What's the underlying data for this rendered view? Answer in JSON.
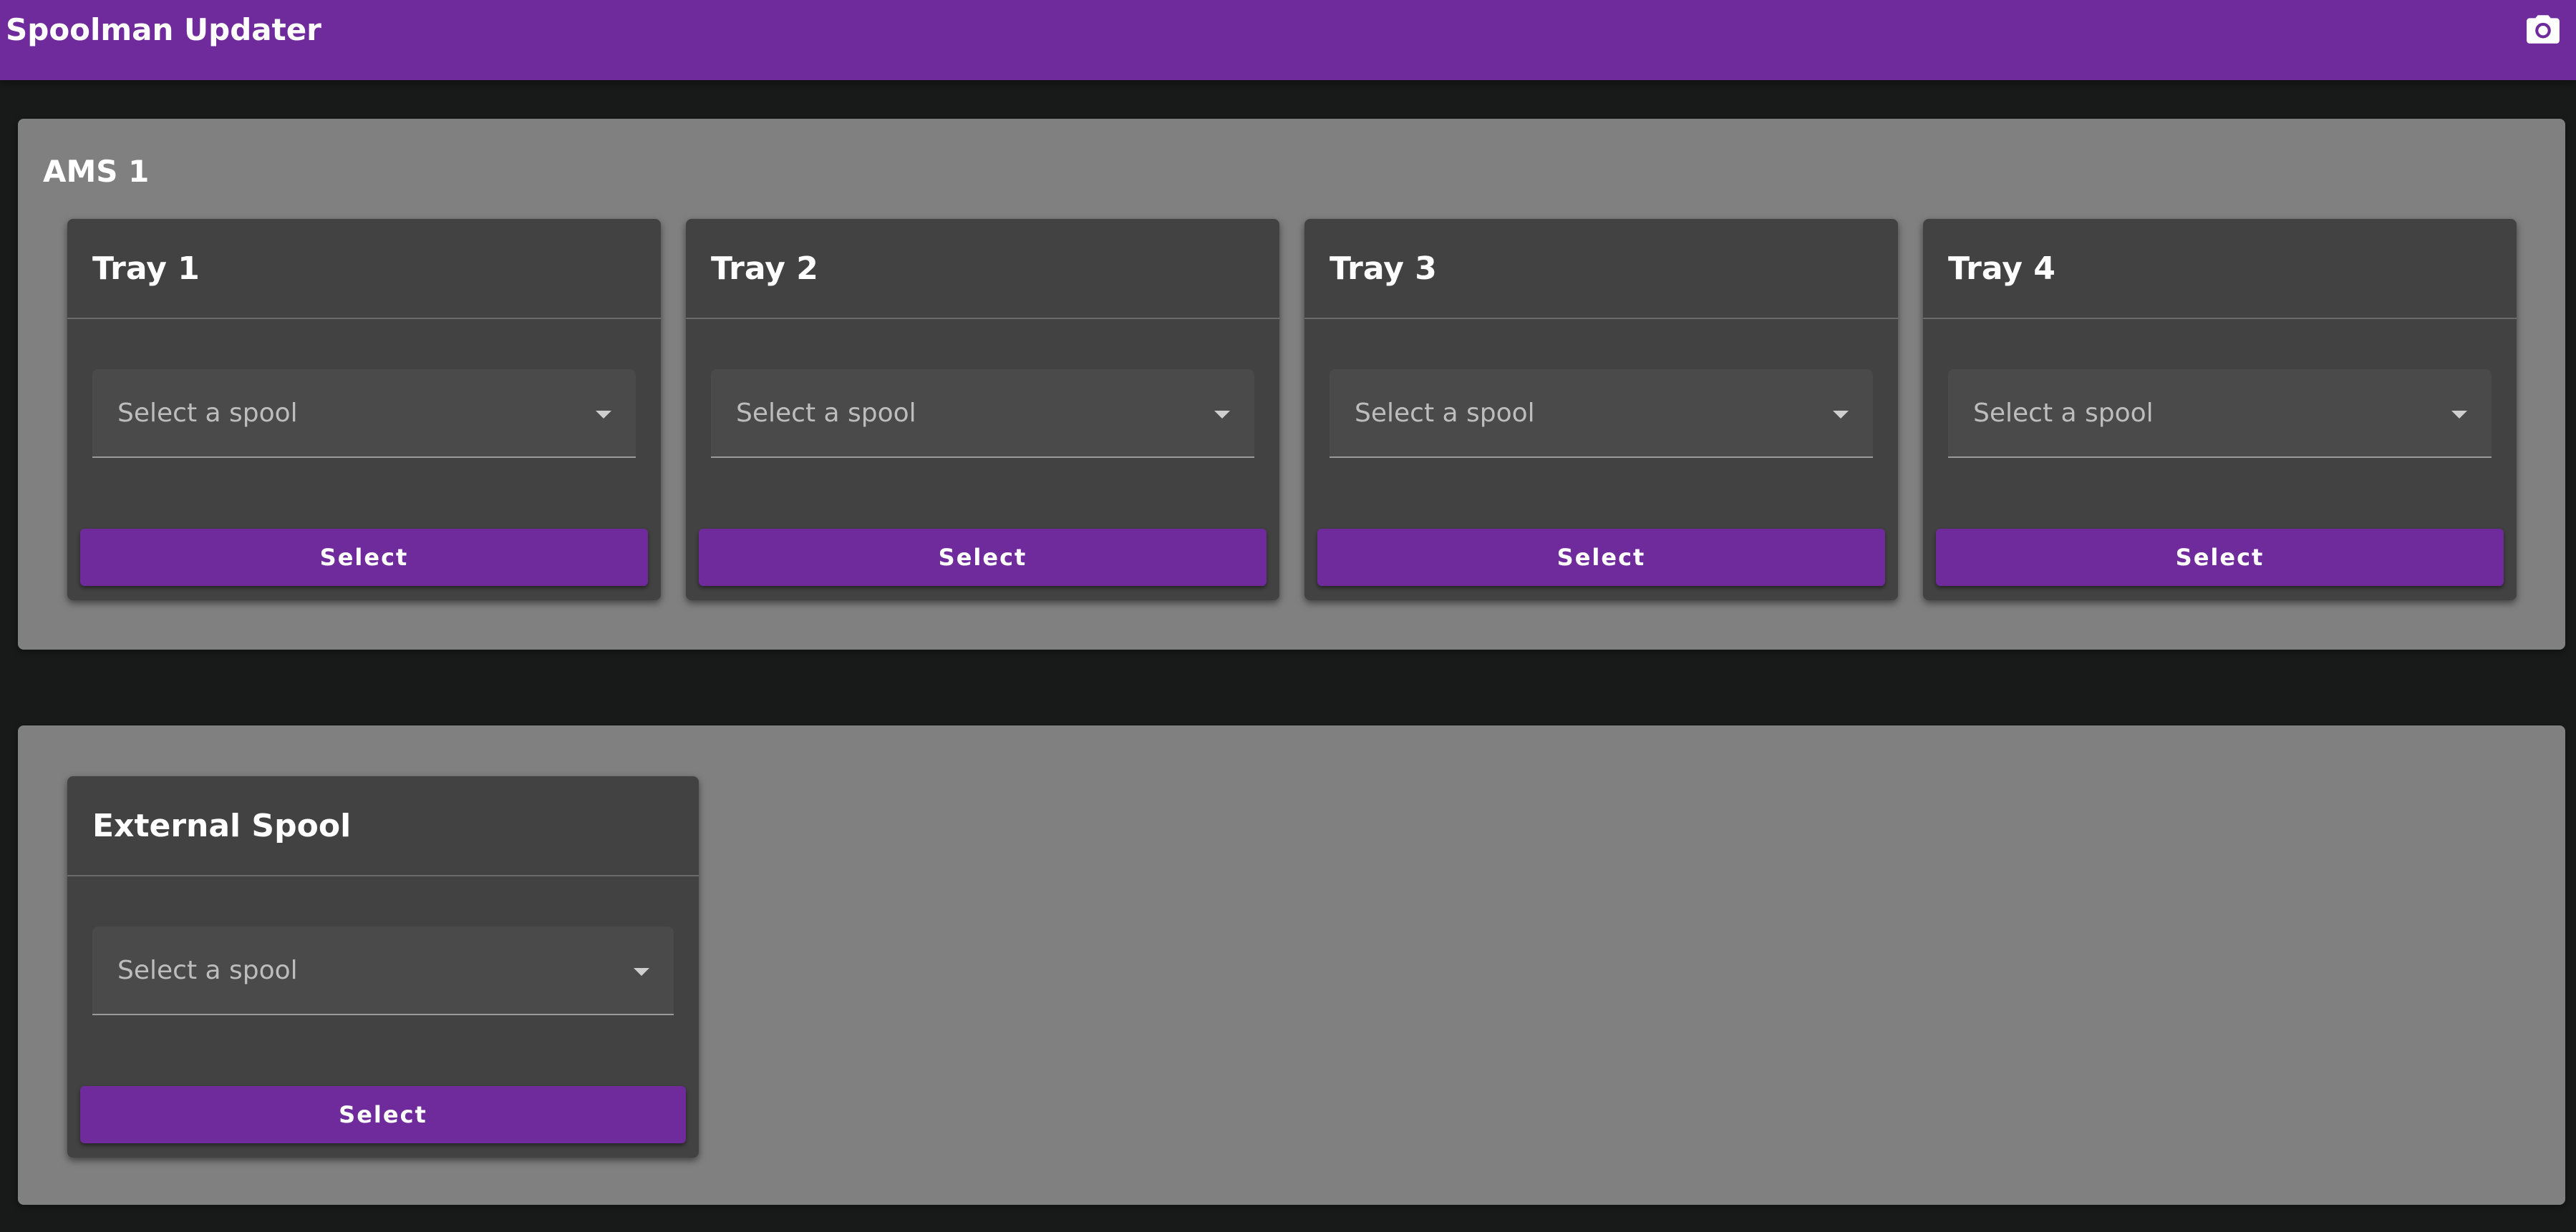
{
  "app_bar": {
    "title": "Spoolman Updater",
    "action_icon": "camera-icon"
  },
  "ams": {
    "title": "AMS 1",
    "trays": [
      {
        "title": "Tray 1",
        "select_placeholder": "Select a spool",
        "button_label": "Select"
      },
      {
        "title": "Tray 2",
        "select_placeholder": "Select a spool",
        "button_label": "Select"
      },
      {
        "title": "Tray 3",
        "select_placeholder": "Select a spool",
        "button_label": "Select"
      },
      {
        "title": "Tray 4",
        "select_placeholder": "Select a spool",
        "button_label": "Select"
      }
    ]
  },
  "external": {
    "title": "External Spool",
    "select_placeholder": "Select a spool",
    "button_label": "Select"
  },
  "colors": {
    "accent": "#6f2a9c",
    "background": "#181a19",
    "panel": "#808080",
    "card": "#424242"
  }
}
